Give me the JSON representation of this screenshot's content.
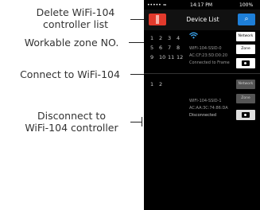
{
  "callouts": {
    "delete_line1": "Delete WiFi-104",
    "delete_line2": "controller list",
    "zone": "Workable zone NO.",
    "connect": "Connect to WiFi-104",
    "disconnect_line1": "Disconnect to",
    "disconnect_line2": "WiFi-104 controller"
  },
  "status_bar": {
    "carrier": "••••• ≈",
    "time": "14:17 PM",
    "battery": "100%"
  },
  "navbar": {
    "title": "Device List",
    "search_icon": "search-icon",
    "delete_icon": "trash-icon"
  },
  "devices": [
    {
      "zones": [
        [
          "1",
          "2",
          "3",
          "4"
        ],
        [
          "5",
          "6",
          "7",
          "8"
        ],
        [
          "9",
          "10",
          "11",
          "12"
        ]
      ],
      "ssid": "WIFI-104-SSID-0",
      "mac": "AC:CF:23:5D:D0:20",
      "status": "Connected to Frame",
      "network_label": "Network",
      "zone_label": "Zone"
    },
    {
      "zones": [
        [
          "1",
          "2"
        ]
      ],
      "ssid": "WIFI-104-SSID-1",
      "mac": "AC:AA:3C:74:86:DA",
      "status": "Disconnected",
      "network_label": "Network",
      "zone_label": "Zone"
    }
  ],
  "colors": {
    "delete": "#e23a2c",
    "search": "#1e7fd8",
    "wifi": "#3fb0ff"
  }
}
